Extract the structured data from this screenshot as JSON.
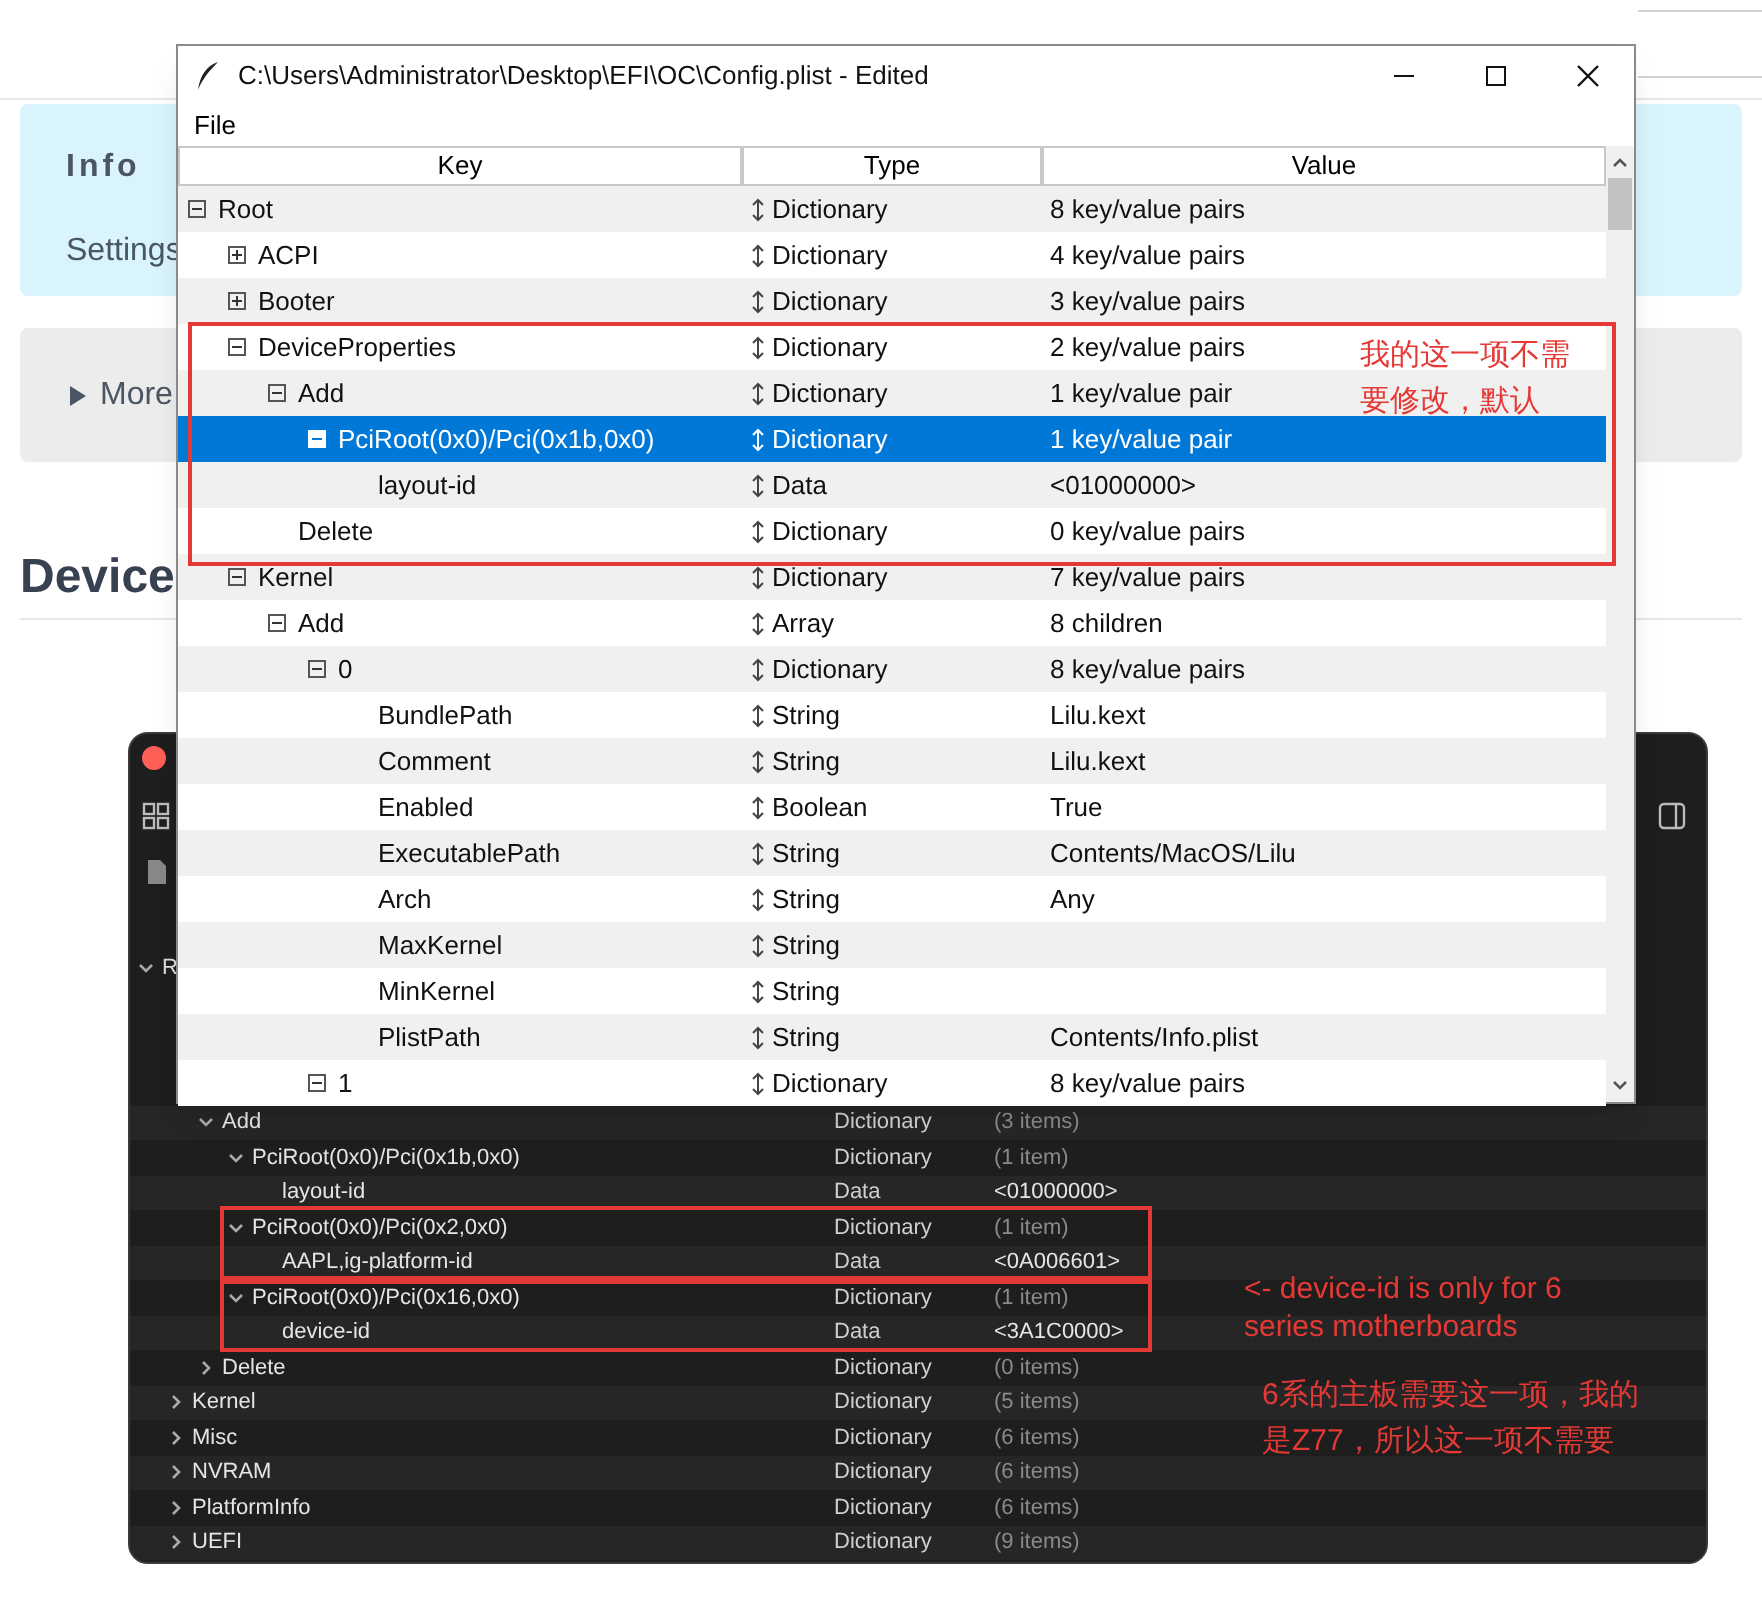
{
  "background_page": {
    "info_card": {
      "title": "Info",
      "text": "Settings"
    },
    "more_section": {
      "label": "More",
      "expanded": false
    },
    "heading": "Device"
  },
  "dark_window": {
    "sidebar_item": "R",
    "device_properties_rows": [
      {
        "key": "Add",
        "type": "Dictionary",
        "value": "(3 items)",
        "expanded": true,
        "children": [
          {
            "key": "PciRoot(0x0)/Pci(0x1b,0x0)",
            "type": "Dictionary",
            "value": "(1 item)",
            "expanded": true,
            "children": [
              {
                "key": "layout-id",
                "type": "Data",
                "value": "<01000000>"
              }
            ]
          },
          {
            "key": "PciRoot(0x0)/Pci(0x2,0x0)",
            "type": "Dictionary",
            "value": "(1 item)",
            "expanded": true,
            "children": [
              {
                "key": "AAPL,ig-platform-id",
                "type": "Data",
                "value": "<0A006601>"
              }
            ]
          },
          {
            "key": "PciRoot(0x0)/Pci(0x16,0x0)",
            "type": "Dictionary",
            "value": "(1 item)",
            "expanded": true,
            "children": [
              {
                "key": "device-id",
                "type": "Data",
                "value": "<3A1C0000>"
              }
            ]
          }
        ]
      },
      {
        "key": "Delete",
        "type": "Dictionary",
        "value": "(0 items)",
        "expanded": false
      }
    ],
    "top_level_rows": [
      {
        "key": "Kernel",
        "type": "Dictionary",
        "value": "(5 items)",
        "expanded": false
      },
      {
        "key": "Misc",
        "type": "Dictionary",
        "value": "(6 items)",
        "expanded": false
      },
      {
        "key": "NVRAM",
        "type": "Dictionary",
        "value": "(6 items)",
        "expanded": false
      },
      {
        "key": "PlatformInfo",
        "type": "Dictionary",
        "value": "(6 items)",
        "expanded": false
      },
      {
        "key": "UEFI",
        "type": "Dictionary",
        "value": "(9 items)",
        "expanded": false
      }
    ]
  },
  "editor_window": {
    "title": "C:\\Users\\Administrator\\Desktop\\EFI\\OC\\Config.plist - Edited",
    "menu": [
      "File"
    ],
    "columns": [
      "Key",
      "Type",
      "Value"
    ],
    "tree": [
      {
        "key": "Root",
        "type": "Dictionary",
        "value": "8 key/value pairs",
        "expanded": true,
        "selected": false,
        "children": [
          {
            "key": "ACPI",
            "type": "Dictionary",
            "value": "4 key/value pairs",
            "expanded": false,
            "selected": false
          },
          {
            "key": "Booter",
            "type": "Dictionary",
            "value": "3 key/value pairs",
            "expanded": false,
            "selected": false
          },
          {
            "key": "DeviceProperties",
            "type": "Dictionary",
            "value": "2 key/value pairs",
            "expanded": true,
            "selected": false,
            "children": [
              {
                "key": "Add",
                "type": "Dictionary",
                "value": "1 key/value pair",
                "expanded": true,
                "selected": false,
                "children": [
                  {
                    "key": "PciRoot(0x0)/Pci(0x1b,0x0)",
                    "type": "Dictionary",
                    "value": "1 key/value pair",
                    "expanded": true,
                    "selected": true,
                    "children": [
                      {
                        "key": "layout-id",
                        "type": "Data",
                        "value": "<01000000>",
                        "selected": false
                      }
                    ]
                  }
                ]
              },
              {
                "key": "Delete",
                "type": "Dictionary",
                "value": "0 key/value pairs",
                "selected": false
              }
            ]
          },
          {
            "key": "Kernel",
            "type": "Dictionary",
            "value": "7 key/value pairs",
            "expanded": true,
            "selected": false,
            "children": [
              {
                "key": "Add",
                "type": "Array",
                "value": "8 children",
                "expanded": true,
                "selected": false,
                "children": [
                  {
                    "key": "0",
                    "type": "Dictionary",
                    "value": "8 key/value pairs",
                    "expanded": true,
                    "selected": false,
                    "children": [
                      {
                        "key": "BundlePath",
                        "type": "String",
                        "value": "Lilu.kext",
                        "selected": false
                      },
                      {
                        "key": "Comment",
                        "type": "String",
                        "value": "Lilu.kext",
                        "selected": false
                      },
                      {
                        "key": "Enabled",
                        "type": "Boolean",
                        "value": "True",
                        "selected": false
                      },
                      {
                        "key": "ExecutablePath",
                        "type": "String",
                        "value": "Contents/MacOS/Lilu",
                        "selected": false
                      },
                      {
                        "key": "Arch",
                        "type": "String",
                        "value": "Any",
                        "selected": false
                      },
                      {
                        "key": "MaxKernel",
                        "type": "String",
                        "selected": false
                      },
                      {
                        "key": "MinKernel",
                        "type": "String",
                        "selected": false
                      },
                      {
                        "key": "PlistPath",
                        "type": "String",
                        "value": "Contents/Info.plist",
                        "selected": false
                      }
                    ]
                  },
                  {
                    "key": "1",
                    "type": "Dictionary",
                    "value": "8 key/value pairs",
                    "expanded": true,
                    "selected": false
                  }
                ]
              }
            ]
          }
        ]
      }
    ]
  },
  "annotations": [
    "我的这一项不需要修改，默认",
    "<- device-id is only for 6 series motherboards",
    "6系的主板需要这一项，我的是Z77，所以这一项不需要"
  ]
}
